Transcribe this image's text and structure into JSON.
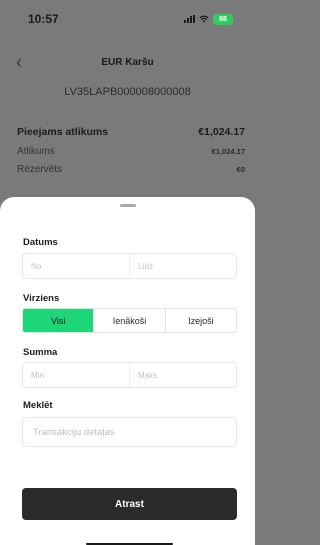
{
  "status_bar": {
    "time": "10:57",
    "battery": "88"
  },
  "header": {
    "title": "EUR Karšu"
  },
  "account": {
    "iban": "LV35LAPB000008000008"
  },
  "balances": {
    "available_label": "Pieejams atlikums",
    "available_value": "€1,024.17",
    "balance_label": "Atlikums",
    "balance_value": "€1,024.17",
    "reserved_label": "Rezervēts",
    "reserved_value": "€0"
  },
  "filter": {
    "date_label": "Datums",
    "date_from_placeholder": "No",
    "date_to_placeholder": "Līdz",
    "direction_label": "Virziens",
    "direction_options": [
      "Visi",
      "Ienākoši",
      "Izejoši"
    ],
    "direction_selected": "Visi",
    "amount_label": "Summa",
    "amount_min_placeholder": "Min",
    "amount_max_placeholder": "Maks",
    "search_label": "Meklēt",
    "search_placeholder": "Transakciju detaļas",
    "submit_label": "Atrast"
  },
  "colors": {
    "accent": "#1ed67a",
    "button": "#2b2b2b",
    "overlay": "#7a7a7a"
  }
}
